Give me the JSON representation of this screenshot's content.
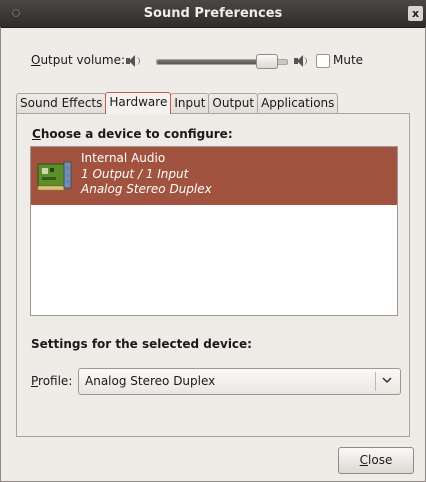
{
  "window": {
    "title": "Sound Preferences",
    "close_glyph": "x"
  },
  "volume": {
    "label": "Output volume:",
    "label_mnemonic": "O",
    "label_rest": "utput volume:",
    "level_fraction": 0.82,
    "mute_label": "Mute",
    "mute_checked": false
  },
  "tabs": [
    {
      "label": "Sound Effects",
      "active": false
    },
    {
      "label": "Hardware",
      "active": true
    },
    {
      "label": "Input",
      "active": false
    },
    {
      "label": "Output",
      "active": false
    },
    {
      "label": "Applications",
      "active": false
    }
  ],
  "hardware": {
    "choose_mnemonic": "C",
    "choose_rest": "hoose a device to configure:",
    "devices": [
      {
        "name": "Internal Audio",
        "io": "1 Output / 1 Input",
        "profile": "Analog Stereo Duplex",
        "selected": true
      }
    ],
    "settings_label": "Settings for the selected device:",
    "profile_mnemonic": "P",
    "profile_rest": "rofile:",
    "profile_value": "Analog Stereo Duplex"
  },
  "buttons": {
    "close_mnemonic": "C",
    "close_rest": "lose"
  },
  "colors": {
    "selection": "#a2533f",
    "active_tab_border": "#c95b4d"
  }
}
